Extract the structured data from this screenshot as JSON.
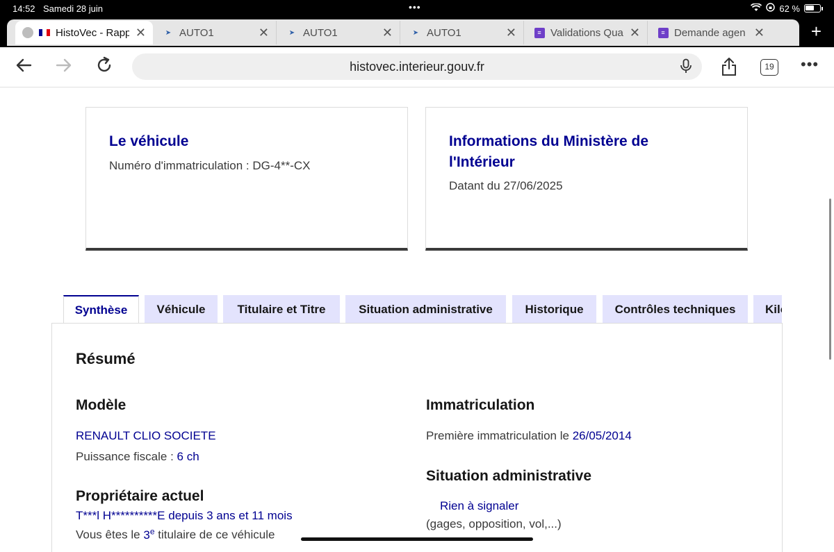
{
  "status": {
    "time": "14:52",
    "date": "Samedi 28 juin",
    "battery": "62 %"
  },
  "tabs": [
    {
      "label": "HistoVec - Rapp",
      "icon": "french-flag-icon"
    },
    {
      "label": "AUTO1",
      "icon": "auto1-icon"
    },
    {
      "label": "AUTO1",
      "icon": "auto1-icon"
    },
    {
      "label": "AUTO1",
      "icon": "auto1-icon"
    },
    {
      "label": "Validations Qua",
      "icon": "forms-icon"
    },
    {
      "label": "Demande agen",
      "icon": "forms-icon"
    }
  ],
  "toolbar": {
    "url": "histovec.interieur.gouv.fr",
    "tab_count": "19"
  },
  "card_vehicle": {
    "title": "Le véhicule",
    "plate_label": "Numéro d'immatriculation :",
    "plate_value": "DG-4**-CX"
  },
  "card_ministry": {
    "title_line1": "Informations du Ministère de",
    "title_line2": "l'Intérieur",
    "date_label": "Datant du 27/06/2025"
  },
  "page_tabs": [
    "Synthèse",
    "Véhicule",
    "Titulaire et Titre",
    "Situation administrative",
    "Historique",
    "Contrôles techniques",
    "Kilo"
  ],
  "summary": {
    "title": "Résumé",
    "model_heading": "Modèle",
    "model_value": "RENAULT CLIO SOCIETE",
    "power_label": "Puissance fiscale :",
    "power_value": "6 ch",
    "owner_heading": "Propriétaire actuel",
    "owner_name": "T***l H**********E",
    "owner_since_label": "depuis",
    "owner_since_value": "3 ans et 11 mois",
    "holder_prefix": "Vous êtes le",
    "holder_rank": "3",
    "holder_rank_sup": "e",
    "holder_suffix": "titulaire de ce véhicule",
    "registration_heading": "Immatriculation",
    "first_reg_label": "Première immatriculation le",
    "first_reg_value": "26/05/2014",
    "admin_heading": "Situation administrative",
    "admin_value": "Rien à signaler",
    "admin_note": "(gages, opposition, vol,...)"
  }
}
